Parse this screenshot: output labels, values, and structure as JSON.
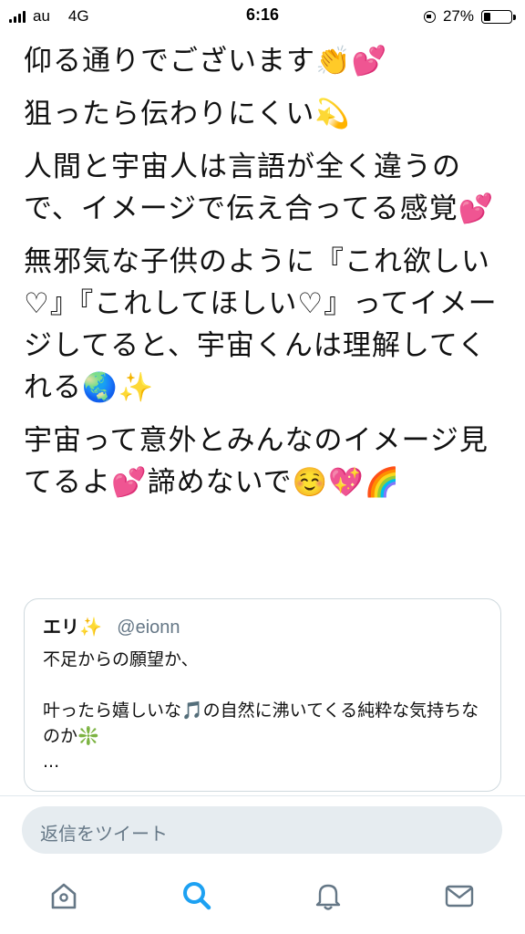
{
  "status_bar": {
    "carrier": "au",
    "network": "4G",
    "time": "6:16",
    "battery_percent": "27%",
    "battery_level": 0.27
  },
  "tweet": {
    "paragraphs": [
      "仰る通りでございます👏💕",
      "狙ったら伝わりにくい💫",
      "人間と宇宙人は言語が全く違うので、イメージで伝え合ってる感覚💕",
      "無邪気な子供のように『これ欲しい♡』『これしてほしい♡』ってイメージしてると、宇宙くんは理解してくれる🌏✨",
      "宇宙って意外とみんなのイメージ見てるよ💕諦めないで☺️💖🌈"
    ]
  },
  "quoted_tweet": {
    "name": "エリ✨",
    "handle": "@eionn",
    "text": "不足からの願望か、\n\n叶ったら嬉しいな🎵の自然に沸いてくる純粋な気持ちなのか❇️\n..."
  },
  "reply": {
    "placeholder": "返信をツイート"
  },
  "tabs": {
    "icons": [
      "home-icon",
      "search-icon",
      "notifications-icon",
      "messages-icon"
    ],
    "active": "search-icon",
    "active_color": "#1da1f2",
    "inactive_color": "#657786"
  }
}
